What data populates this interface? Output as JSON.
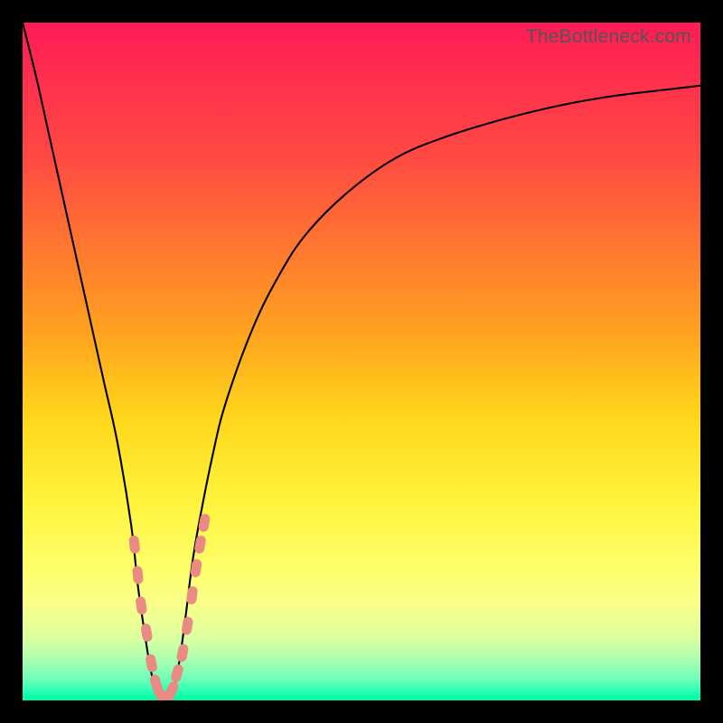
{
  "watermark": "TheBottleneck.com",
  "colors": {
    "background_frame": "#000000",
    "gradient_top": "#ff1b55",
    "gradient_mid": "#fff23a",
    "gradient_bottom": "#00ff9a",
    "curve": "#000000",
    "markers": "#e98b82"
  },
  "chart_data": {
    "type": "line",
    "title": "",
    "subtitle": "",
    "xlabel": "",
    "ylabel": "",
    "xlim": [
      0,
      100
    ],
    "ylim": [
      0,
      100
    ],
    "grid": false,
    "legend": "none",
    "note": "No axes or tick labels are rendered; x is a normalized parameter 0–100 and y is bottleneck percentage 0–100. Values below are estimated from the curve shape relative to the full plot area.",
    "series": [
      {
        "name": "bottleneck-curve",
        "x": [
          0,
          2,
          4,
          6,
          8,
          10,
          12,
          14,
          16,
          17,
          18,
          19,
          20,
          21,
          22,
          23,
          24,
          25,
          26,
          28,
          30,
          34,
          38,
          42,
          48,
          55,
          62,
          70,
          78,
          86,
          94,
          100
        ],
        "values": [
          100,
          92,
          83,
          74,
          65,
          56,
          47,
          38,
          26,
          17,
          10,
          4,
          1,
          0,
          1,
          5,
          12,
          20,
          26,
          36,
          44,
          55,
          63,
          69,
          75,
          80,
          83,
          85.5,
          87.5,
          89,
          90,
          90.7
        ]
      }
    ],
    "markers": {
      "name": "highlight-points",
      "shape": "rounded",
      "color": "#e98b82",
      "x": [
        16.5,
        17.0,
        17.5,
        18.3,
        19.0,
        19.7,
        20.4,
        21.1,
        22.0,
        22.8,
        23.6,
        24.3,
        25.0,
        25.6,
        26.2,
        26.8
      ],
      "values": [
        23.0,
        18.5,
        14.0,
        10.0,
        5.5,
        2.5,
        0.8,
        0.4,
        1.5,
        4.0,
        7.0,
        11.0,
        15.5,
        19.5,
        23.0,
        26.2
      ]
    }
  }
}
